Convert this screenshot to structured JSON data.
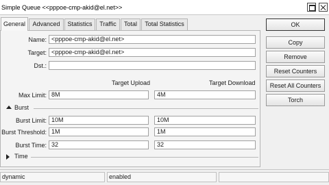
{
  "window": {
    "title": "Simple Queue <<pppoe-cmp-akid@el.net>>",
    "max_icon": "maximize-icon",
    "close_icon": "close-icon"
  },
  "tabs": [
    "General",
    "Advanced",
    "Statistics",
    "Traffic",
    "Total",
    "Total Statistics"
  ],
  "active_tab": "General",
  "form": {
    "name_label": "Name:",
    "name_value": "<pppoe-cmp-akid@el.net>",
    "target_label": "Target:",
    "target_value": "<pppoe-cmp-akid@el.net>",
    "dst_label": "Dst.:",
    "dst_value": "",
    "col_upload": "Target Upload",
    "col_download": "Target Download",
    "max_limit_label": "Max Limit:",
    "max_limit_upload": "8M",
    "max_limit_download": "4M",
    "burst_section": "Burst",
    "burst_limit_label": "Burst Limit:",
    "burst_limit_upload": "10M",
    "burst_limit_download": "10M",
    "burst_threshold_label": "Burst Threshold:",
    "burst_threshold_upload": "1M",
    "burst_threshold_download": "1M",
    "burst_time_label": "Burst Time:",
    "burst_time_upload": "32",
    "burst_time_download": "32",
    "time_section": "Time"
  },
  "buttons": [
    "OK",
    "Copy",
    "Remove",
    "Reset Counters",
    "Reset All Counters",
    "Torch"
  ],
  "status": {
    "left": "dynamic",
    "middle": "enabled",
    "right": ""
  },
  "colors": {
    "window_bg": "#f0f0f0",
    "field_bg": "#ffffff",
    "border": "#a0a0a0"
  }
}
